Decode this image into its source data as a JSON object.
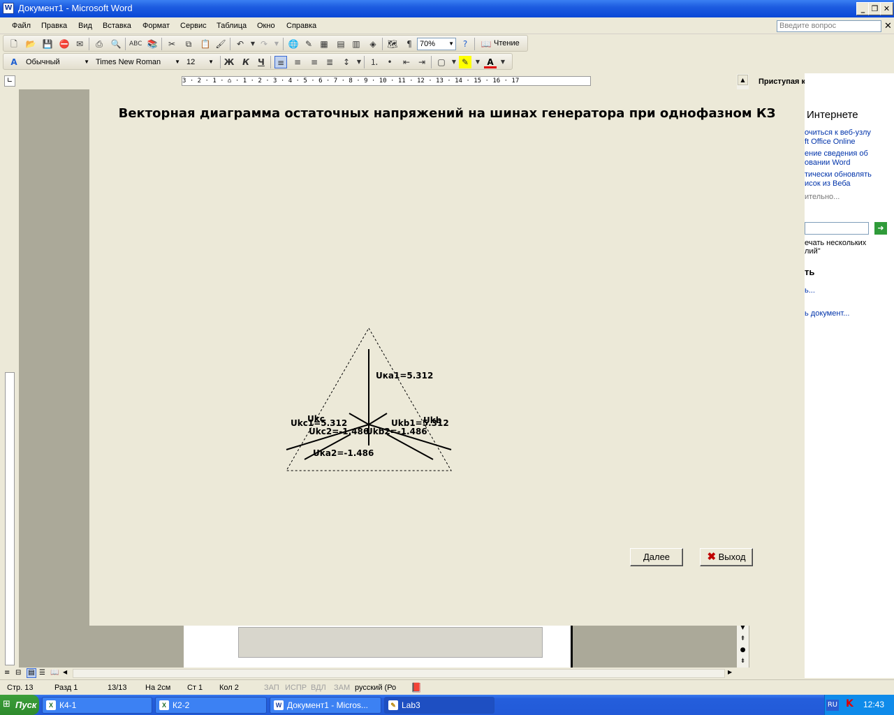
{
  "window": {
    "title": "Документ1 - Microsoft Word"
  },
  "menu": [
    "Файл",
    "Правка",
    "Вид",
    "Вставка",
    "Формат",
    "Сервис",
    "Таблица",
    "Окно",
    "Справка"
  ],
  "ask_placeholder": "Введите вопрос",
  "toolbar": {
    "zoom": "70%",
    "read_label": "Чтение",
    "style": "Обычный",
    "font": "Times New Roman",
    "size": "12"
  },
  "ruler_text": "3 · 2 · 1 · ⌂ · 1 · 2 · 3 · 4 · 5 · 6 · 7 · 8 · 9 · 10 · 11 · 12 · 13 · 14 · 15 · 16 · 17",
  "lab": {
    "title": "Векторная диаграмма остаточных напряжений на шинах генератора при однофазном КЗ",
    "labels": {
      "uka1": "Uка1=5.312",
      "ukc1": "Ukc1=5.312",
      "ukc": "Ukc",
      "ukb1": "Ukb1=5.312",
      "ukb": "Ukb",
      "ukc2": "Ukc2=-1.486",
      "ukb2": "Ukb2=-1.486",
      "uka2": "Uка2=-1.486"
    },
    "next_button": "Далее",
    "exit_button": "Выход"
  },
  "taskpane": {
    "title": "Приступая к работе",
    "section": "Интернете",
    "links": [
      "очиться к веб-узлу",
      "ft Office Online",
      "ение сведения об",
      "овании Word",
      "тически обновлять",
      "исок из Веба",
      "ительно..."
    ],
    "search_note": [
      "ечать нескольких",
      "лий\""
    ],
    "section2": "ть",
    "link2": "ь...",
    "link3": "ь документ..."
  },
  "status": {
    "page": "Стр. 13",
    "section": "Разд 1",
    "pages": "13/13",
    "at": "На 2см",
    "line": "Ст 1",
    "col": "Кол 2",
    "rec": "ЗАП",
    "trk": "ИСПР",
    "ext": "ВДЛ",
    "ovr": "ЗАМ",
    "lang": "русский (Ро"
  },
  "taskbar": {
    "start": "Пуск",
    "tasks": [
      "К4-1",
      "К2-2",
      "Документ1 - Micros...",
      "Lab3"
    ],
    "lang": "RU",
    "clock": "12:43"
  }
}
